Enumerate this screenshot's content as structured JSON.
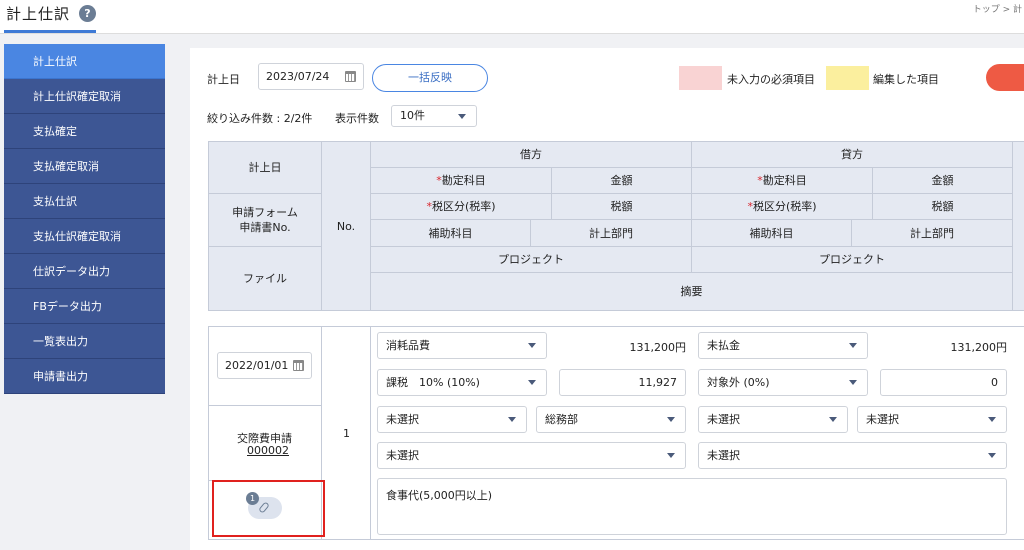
{
  "header": {
    "title": "計上仕訳",
    "help_icon": "?",
    "breadcrumb": "トップ > 計"
  },
  "sidebar": {
    "items": [
      {
        "label": "計上仕訳",
        "active": true
      },
      {
        "label": "計上仕訳確定取消"
      },
      {
        "label": "支払確定"
      },
      {
        "label": "支払確定取消"
      },
      {
        "label": "支払仕訳"
      },
      {
        "label": "支払仕訳確定取消"
      },
      {
        "label": "仕訳データ出力"
      },
      {
        "label": "FBデータ出力"
      },
      {
        "label": "一覧表出力"
      },
      {
        "label": "申請書出力"
      }
    ]
  },
  "toolbar": {
    "date_label": "計上日",
    "date_value": "2023/07/24",
    "bulk_button": "一括反映",
    "legend_required": "未入力の必須項目",
    "legend_edited": "編集した項目",
    "legend_required_color": "#f9d3d3",
    "legend_edited_color": "#fbef9e",
    "filter_count": "絞り込み件数 : 2/2件",
    "per_page_label": "表示件数",
    "per_page_value": "10件"
  },
  "table_header": {
    "col_date": "計上日",
    "col_form": "申請フォーム\n申請書No.",
    "col_file": "ファイル",
    "col_no": "No.",
    "debit": "借方",
    "credit": "貸方",
    "account": "勘定科目",
    "amount": "金額",
    "tax_class": "税区分(税率)",
    "tax_amount": "税額",
    "sub_account": "補助科目",
    "department": "計上部門",
    "project": "プロジェクト",
    "summary": "摘要",
    "required_mark": "*"
  },
  "row": {
    "date": "2022/01/01",
    "form_name": "交際費申請",
    "form_no": "000002",
    "no": "1",
    "debit_account": "消耗品費",
    "debit_amount": "131,200円",
    "debit_tax_class": "課税　10% (10%)",
    "debit_tax_amount": "11,927",
    "debit_sub_account": "未選択",
    "debit_department": "総務部",
    "debit_project": "未選択",
    "credit_account": "未払金",
    "credit_amount": "131,200円",
    "credit_tax_class": "対象外 (0%)",
    "credit_tax_amount": "0",
    "credit_sub_account": "未選択",
    "credit_department": "未選択",
    "credit_project": "未選択",
    "summary": "食事代(5,000円以上)",
    "attachment_count": "1"
  }
}
